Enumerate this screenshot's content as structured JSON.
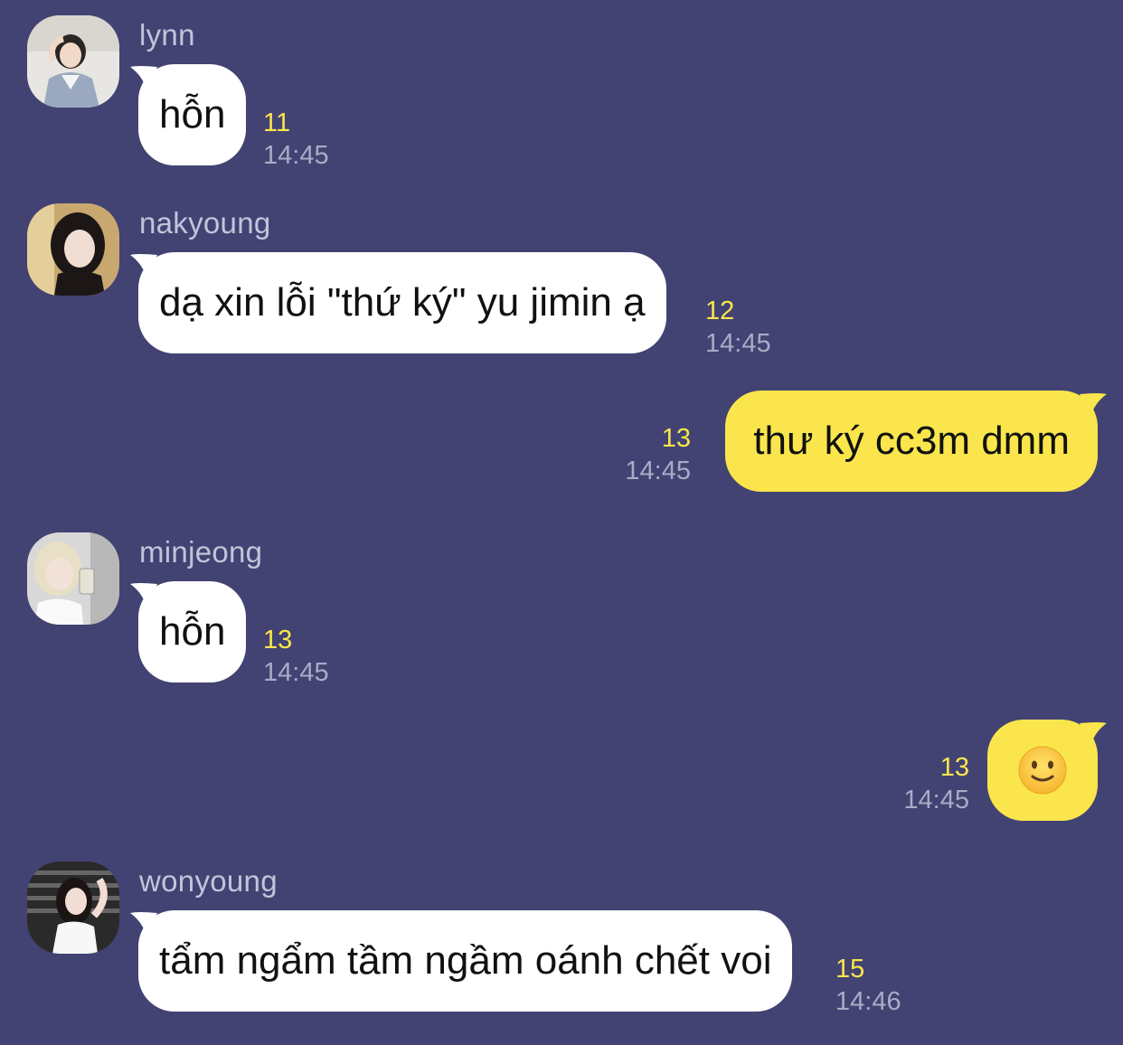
{
  "messages": [
    {
      "sender": "lynn",
      "text": "hỗn",
      "unread": "11",
      "time": "14:45"
    },
    {
      "sender": "nakyoung",
      "text": "dạ xin lỗi \"thứ ký\" yu jimin ạ",
      "unread": "12",
      "time": "14:45"
    },
    {
      "text": "thư ký cc3m dmm",
      "unread": "13",
      "time": "14:45"
    },
    {
      "sender": "minjeong",
      "text": "hỗn",
      "unread": "13",
      "time": "14:45"
    },
    {
      "emoji": "slightly-smiling-face",
      "unread": "13",
      "time": "14:45"
    },
    {
      "sender": "wonyoung",
      "text": "tẩm ngẩm tầm ngầm oánh chết voi",
      "unread": "15",
      "time": "14:46"
    }
  ],
  "colors": {
    "background": "#424372",
    "incoming_bubble": "#ffffff",
    "outgoing_bubble": "#fae64c",
    "unread": "#fae64c",
    "time": "#a9abc7"
  }
}
